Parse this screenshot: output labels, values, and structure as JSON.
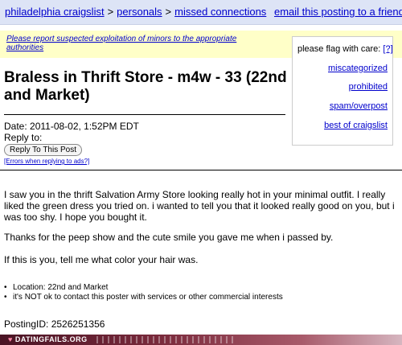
{
  "breadcrumb": {
    "site": "philadelphia craigslist",
    "sep1": ">",
    "section": "personals",
    "sep2": ">",
    "subsection": "missed connections",
    "email_link": "email this posting to a friend"
  },
  "warning": {
    "text": "Please report suspected exploitation of minors to the appropriate authorities"
  },
  "flag_box": {
    "title": "please flag with care:",
    "help": "[?]",
    "items": [
      "miscategorized",
      "prohibited",
      "spam/overpost",
      "best of craigslist"
    ]
  },
  "post": {
    "title": "Braless in Thrift Store - m4w - 33 (22nd and Market)",
    "date": "Date: 2011-08-02, 1:52PM EDT",
    "reply_to": "Reply to:",
    "reply_button": "Reply To This Post",
    "errors_link": "[Errors when replying to ads?]",
    "paragraphs": [
      "I saw you in the thrift Salvation Army Store looking really hot in your minimal outfit. I really liked the green dress you tried on. i wanted to tell you that it looked really good on you, but i was too shy. I hope you bought it.",
      "Thanks for the peep show and the cute smile you gave me when i passed by.",
      "If this is you, tell me what color your hair was."
    ],
    "bullets": [
      "Location: 22nd and Market",
      "it's NOT ok to contact this poster with services or other commercial interests"
    ],
    "posting_id": "PostingID: 2526251356"
  },
  "footer": {
    "logo": "DATINGFAILS.ORG"
  },
  "colors": {
    "link": "#0000cc",
    "top_bar": "#dde4f6",
    "warning_bg": "#ffffc8"
  }
}
